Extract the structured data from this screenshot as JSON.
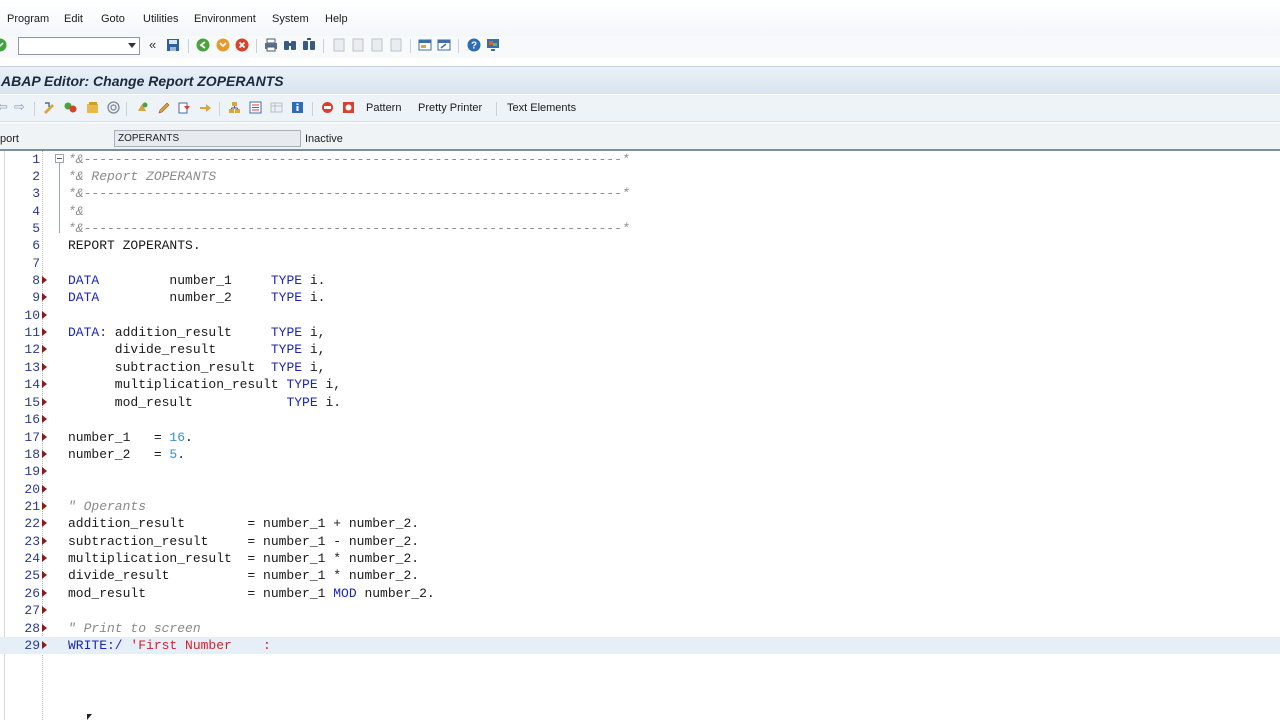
{
  "menu": [
    "Program",
    "Edit",
    "Goto",
    "Utilities",
    "Environment",
    "System",
    "Help"
  ],
  "toolbar": {
    "command_field_value": ""
  },
  "window_title": "ABAP Editor: Change Report ZOPERANTS",
  "app_toolbar": {
    "pattern": "Pattern",
    "pretty_printer": "Pretty Printer",
    "text_elements": "Text Elements"
  },
  "report_row": {
    "label": "port",
    "value": "ZOPERANTS",
    "status": "Inactive"
  },
  "lines": [
    {
      "n": "1"
    },
    {
      "n": "2"
    },
    {
      "n": "3"
    },
    {
      "n": "4"
    },
    {
      "n": "5"
    },
    {
      "n": "6"
    },
    {
      "n": "7"
    },
    {
      "n": "8"
    },
    {
      "n": "9"
    },
    {
      "n": "10"
    },
    {
      "n": "11"
    },
    {
      "n": "12"
    },
    {
      "n": "13"
    },
    {
      "n": "14"
    },
    {
      "n": "15"
    },
    {
      "n": "16"
    },
    {
      "n": "17"
    },
    {
      "n": "18"
    },
    {
      "n": "19"
    },
    {
      "n": "20"
    },
    {
      "n": "21"
    },
    {
      "n": "22"
    },
    {
      "n": "23"
    },
    {
      "n": "24"
    },
    {
      "n": "25"
    },
    {
      "n": "26"
    },
    {
      "n": "27"
    },
    {
      "n": "28"
    },
    {
      "n": "29"
    }
  ],
  "code": {
    "l1": "*&---------------------------------------------------------------------*",
    "l2": "*& Report ZOPERANTS",
    "l3": "*&---------------------------------------------------------------------*",
    "l4": "*&",
    "l5": "*&---------------------------------------------------------------------*",
    "l6": "REPORT ZOPERANTS.",
    "l8_kw": "DATA",
    "l8_a": "         number_1     ",
    "l8_kw2": "TYPE",
    "l8_b": " i.",
    "l9_kw": "DATA",
    "l9_a": "         number_2     ",
    "l9_kw2": "TYPE",
    "l9_b": " i.",
    "l11_kw": "DATA:",
    "l11_a": " addition_result     ",
    "l11_kw2": "TYPE",
    "l11_b": " i,",
    "l12_a": "      divide_result       ",
    "l12_kw2": "TYPE",
    "l12_b": " i,",
    "l13_a": "      subtraction_result  ",
    "l13_kw2": "TYPE",
    "l13_b": " i,",
    "l14_a": "      multiplication_result ",
    "l14_kw2": "TYPE",
    "l14_b": " i,",
    "l15_a": "      mod_result            ",
    "l15_kw2": "TYPE",
    "l15_b": " i.",
    "l17_a": "number_1   = ",
    "l17_num": "16",
    "l17_b": ".",
    "l18_a": "number_2   = ",
    "l18_num": "5",
    "l18_b": ".",
    "l21": "\" Operants",
    "l22": "addition_result        = number_1 + number_2.",
    "l23": "subtraction_result     = number_1 - number_2.",
    "l24": "multiplication_result  = number_1 * number_2.",
    "l25": "divide_result          = number_1 * number_2.",
    "l26_a": "mod_result             = number_1 ",
    "l26_kw": "MOD",
    "l26_b": " number_2.",
    "l28": "\" Print to screen",
    "l29_kw": "WRITE:/",
    "l29_str": " 'First Number    :"
  }
}
